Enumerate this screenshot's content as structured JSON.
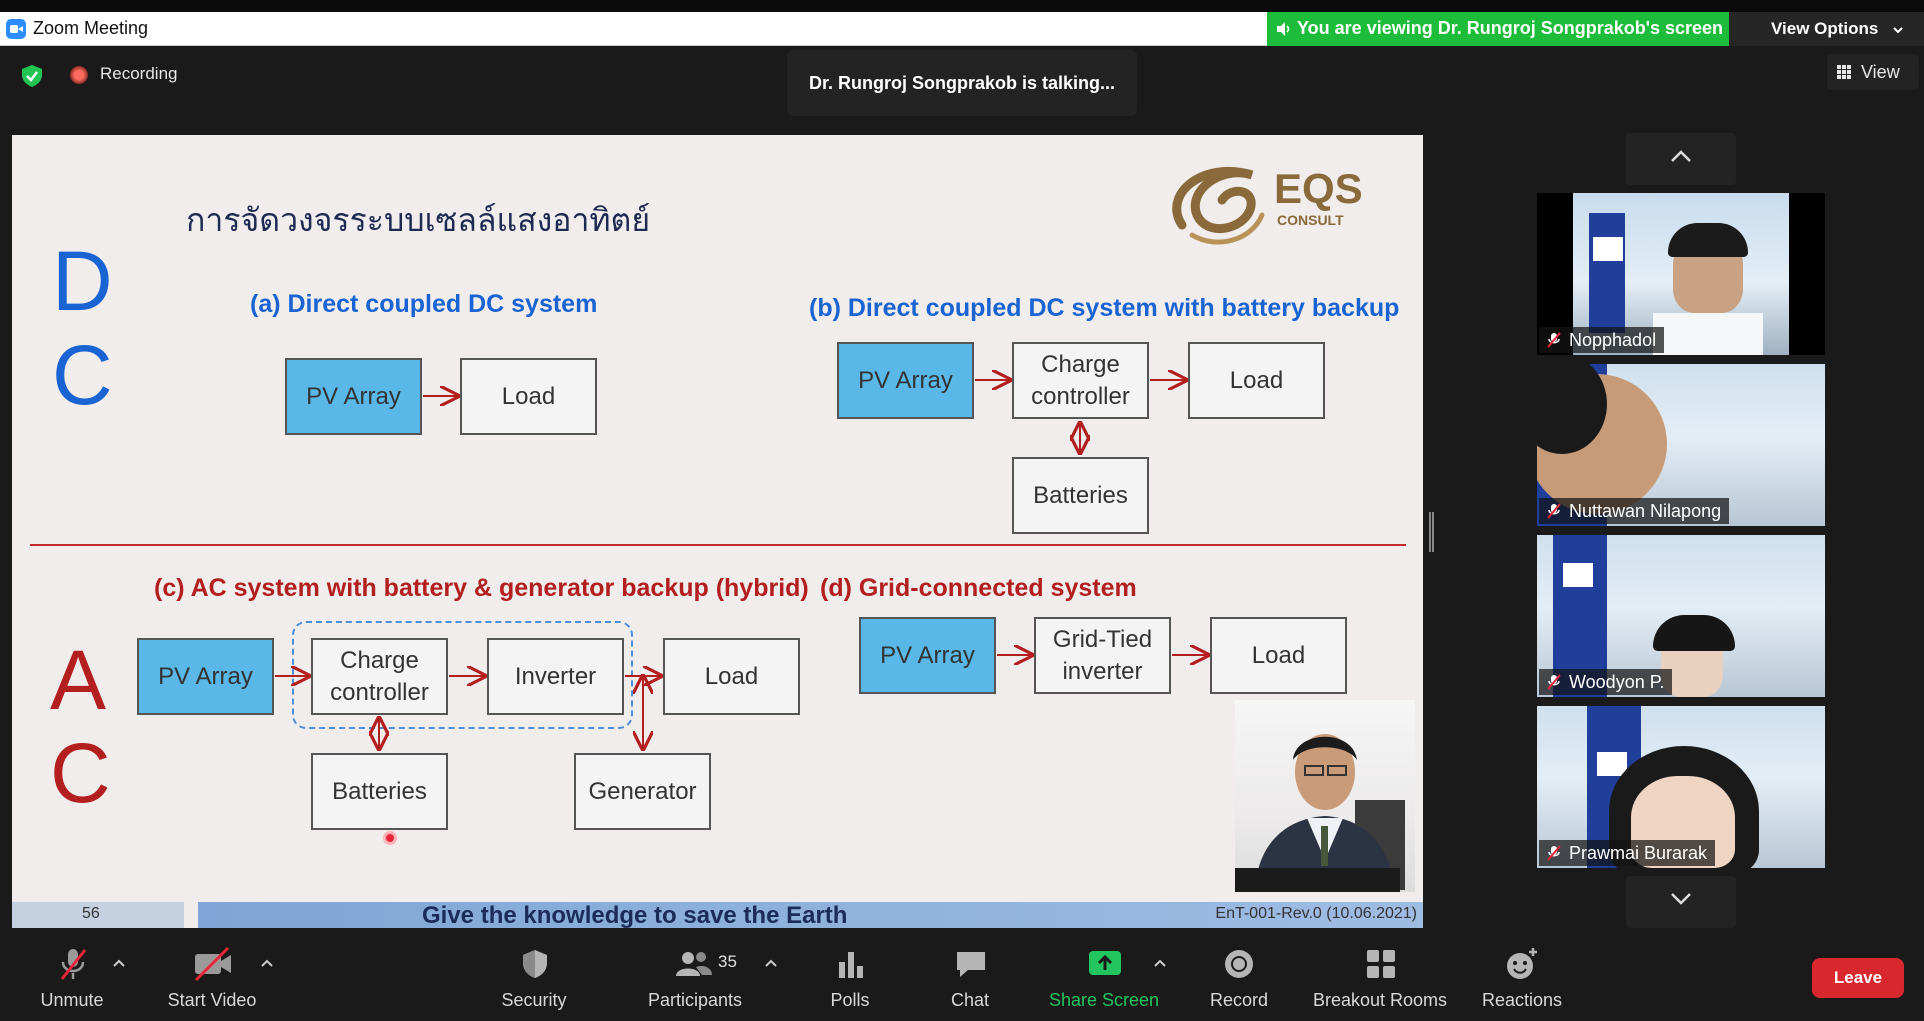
{
  "window": {
    "title": "Zoom Meeting",
    "viewing_banner": "You are viewing Dr. Rungroj Songprakob's screen",
    "view_options": "View Options"
  },
  "overlay": {
    "recording": "Recording",
    "talking": "Dr. Rungroj Songprakob is talking...",
    "view": "View"
  },
  "slide": {
    "title_thai": "การจัดวงจรระบบเซลล์แสงอาทิตย์",
    "logo_text": "EQS",
    "logo_sub": "CONSULT",
    "dc_letters": [
      "D",
      "C"
    ],
    "ac_letters": [
      "A",
      "C"
    ],
    "section_a": "(a) Direct coupled DC system",
    "section_b": "(b) Direct coupled DC system with battery backup",
    "section_c": "(c) AC system with battery & generator backup (hybrid)",
    "section_d": "(d) Grid-connected system",
    "boxes": {
      "pv_array": "PV Array",
      "load": "Load",
      "charge_controller": [
        "Charge",
        "controller"
      ],
      "batteries": "Batteries",
      "inverter": "Inverter",
      "generator": "Generator",
      "grid_tied": [
        "Grid-Tied",
        "inverter"
      ]
    },
    "page_number": "56",
    "footer_message": "Give the knowledge to save the Earth",
    "footer_rev": "EnT-001-Rev.0 (10.06.2021)"
  },
  "participants": [
    {
      "name": "Nopphadol",
      "muted": true
    },
    {
      "name": "Nuttawan Nilapong",
      "muted": true
    },
    {
      "name": "Woodyon P.",
      "muted": true
    },
    {
      "name": "Prawmai Burarak",
      "muted": true
    }
  ],
  "toolbar": {
    "unmute": "Unmute",
    "start_video": "Start Video",
    "security": "Security",
    "participants": "Participants",
    "participants_count": "35",
    "polls": "Polls",
    "chat": "Chat",
    "share_screen": "Share Screen",
    "record": "Record",
    "breakout_rooms": "Breakout Rooms",
    "reactions": "Reactions",
    "leave": "Leave"
  },
  "colors": {
    "share_green": "#1dbd3b",
    "leave_red": "#d9272e",
    "pv_blue": "#5ab8e8",
    "dc_blue": "#1a63d2",
    "ac_red": "#b31e1e"
  }
}
